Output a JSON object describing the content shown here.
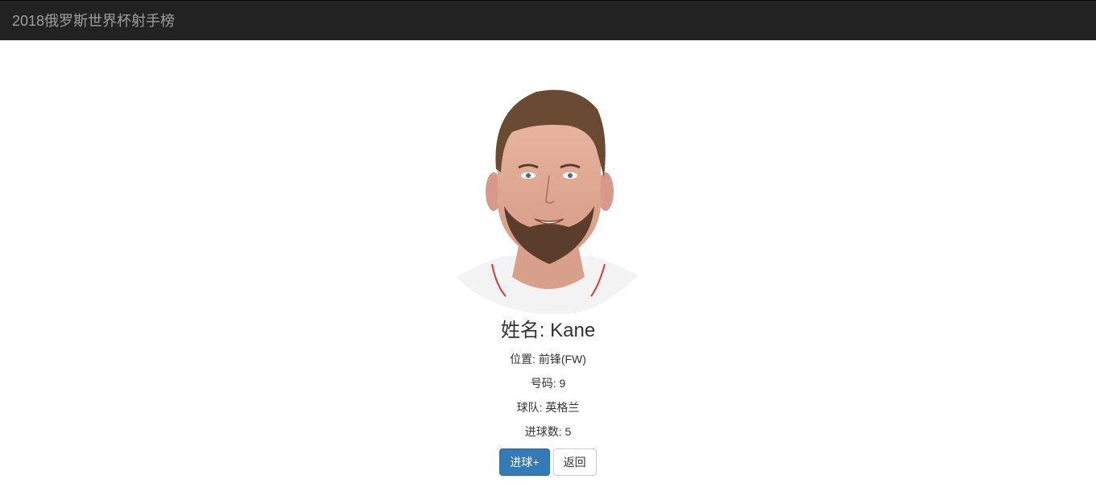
{
  "navbar": {
    "brand": "2018俄罗斯世界杯射手榜"
  },
  "player": {
    "photo_icon": "player-portrait",
    "name_line": "姓名: Kane",
    "position_line": "位置: 前锋(FW)",
    "number_line": "号码: 9",
    "team_line": "球队: 英格兰",
    "goals_line": "进球数: 5"
  },
  "actions": {
    "add_goal_label": "进球+",
    "back_label": "返回"
  },
  "colors": {
    "navbar_bg": "#222222",
    "brand_text": "#9d9d9d",
    "primary": "#337ab7"
  }
}
